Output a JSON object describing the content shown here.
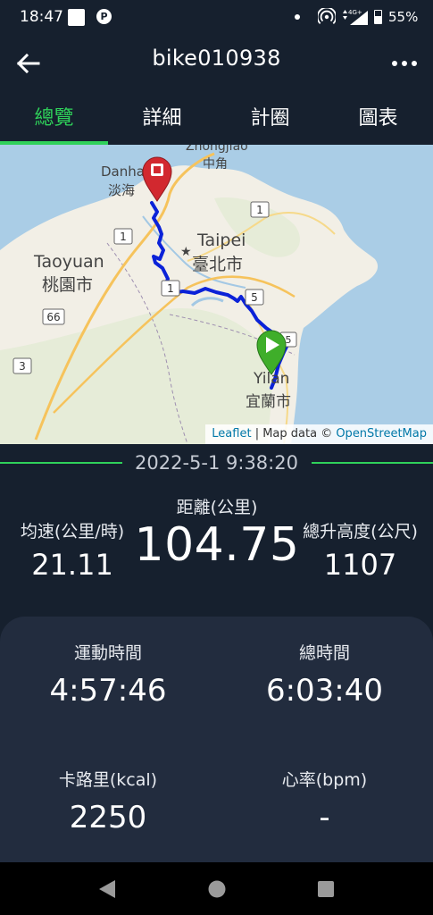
{
  "status_bar": {
    "time": "18:47",
    "network": "4G+",
    "battery": "55%"
  },
  "header": {
    "title": "bike010938",
    "back_icon": "arrow-left-icon",
    "more_icon": "more-horizontal-icon"
  },
  "tabs": [
    {
      "label": "總覽",
      "active": true
    },
    {
      "label": "詳細",
      "active": false
    },
    {
      "label": "計圈",
      "active": false
    },
    {
      "label": "圖表",
      "active": false
    }
  ],
  "map": {
    "labels": {
      "zhongjiao": "Zhongjiao",
      "zhongjiao_zh": "中角",
      "danhai": "Danhai",
      "danhai_zh": "淡海",
      "taipei": "Taipei",
      "taipei_zh": "臺北市",
      "taoyuan": "Taoyuan",
      "taoyuan_zh": "桃園市",
      "yilan": "Yilan",
      "yilan_zh": "宜蘭市"
    },
    "road_shields": [
      "1",
      "1",
      "66",
      "3",
      "5",
      "1",
      "5"
    ],
    "attribution": {
      "leaflet": "Leaflet",
      "separator": " | Map data © ",
      "osm": "OpenStreetMap"
    },
    "colors": {
      "route": "#0b22d8",
      "end_marker": "#d2282f",
      "start_marker": "#3fae2a",
      "sea": "#aacde6",
      "land": "#f2efe6"
    }
  },
  "session": {
    "datetime": "2022-5-1 9:38:20"
  },
  "stats": {
    "distance_label": "距離(公里)",
    "distance_value": "104.75",
    "avg_speed_label": "均速(公里/時)",
    "avg_speed_value": "21.11",
    "elevation_label": "總升高度(公尺)",
    "elevation_value": "1107"
  },
  "panel": {
    "moving_time_label": "運動時間",
    "moving_time_value": "4:57:46",
    "total_time_label": "總時間",
    "total_time_value": "6:03:40",
    "calories_label": "卡路里(kcal)",
    "calories_value": "2250",
    "heart_rate_label": "心率(bpm)",
    "heart_rate_value": "-"
  },
  "nav_bar": {
    "back_icon": "triangle-back-icon",
    "home_icon": "circle-home-icon",
    "recents_icon": "square-recents-icon"
  }
}
